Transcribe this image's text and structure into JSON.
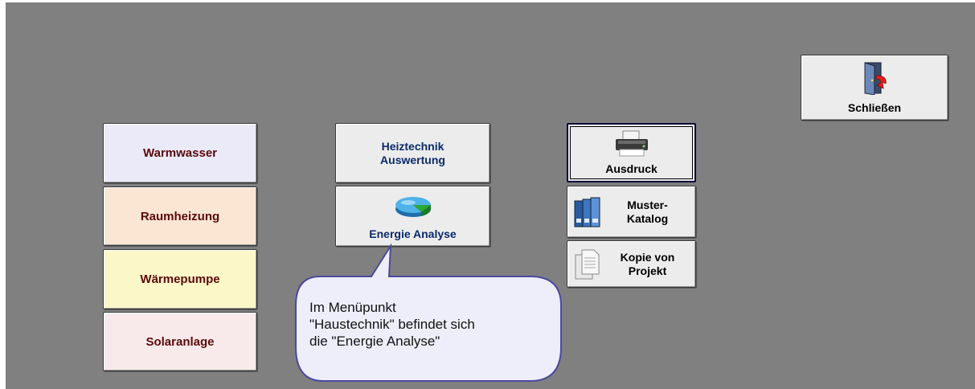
{
  "left_menu": {
    "items": [
      {
        "label": "Warmwasser",
        "color": "#eaeaf8"
      },
      {
        "label": "Raumheizung",
        "color": "#fbe6d4"
      },
      {
        "label": "Wärmepumpe",
        "color": "#fbf7c8"
      },
      {
        "label": "Solaranlage",
        "color": "#f8eaea"
      }
    ]
  },
  "middle_menu": {
    "heiztechnik_line1": "Heiztechnik",
    "heiztechnik_line2": "Auswertung",
    "energie_label": "Energie Analyse",
    "energie_icon": "pie-chart-icon"
  },
  "right_menu": {
    "ausdruck_label": "Ausdruck",
    "ausdruck_icon": "printer-icon",
    "muster_line1": "Muster-",
    "muster_line2": "Katalog",
    "muster_icon": "binders-icon",
    "kopie_line1": "Kopie von",
    "kopie_line2": "Projekt",
    "kopie_icon": "copy-documents-icon"
  },
  "close_button": {
    "label": "Schließen",
    "icon": "exit-door-icon"
  },
  "callout": {
    "line1": "Im Menüpunkt",
    "line2": "\"Haustechnik\" befindet sich",
    "line3": "die \"Energie Analyse\""
  },
  "colors": {
    "panel_bg": "#808080",
    "button_bg": "#ececec",
    "callout_border": "#4a4a9e"
  }
}
